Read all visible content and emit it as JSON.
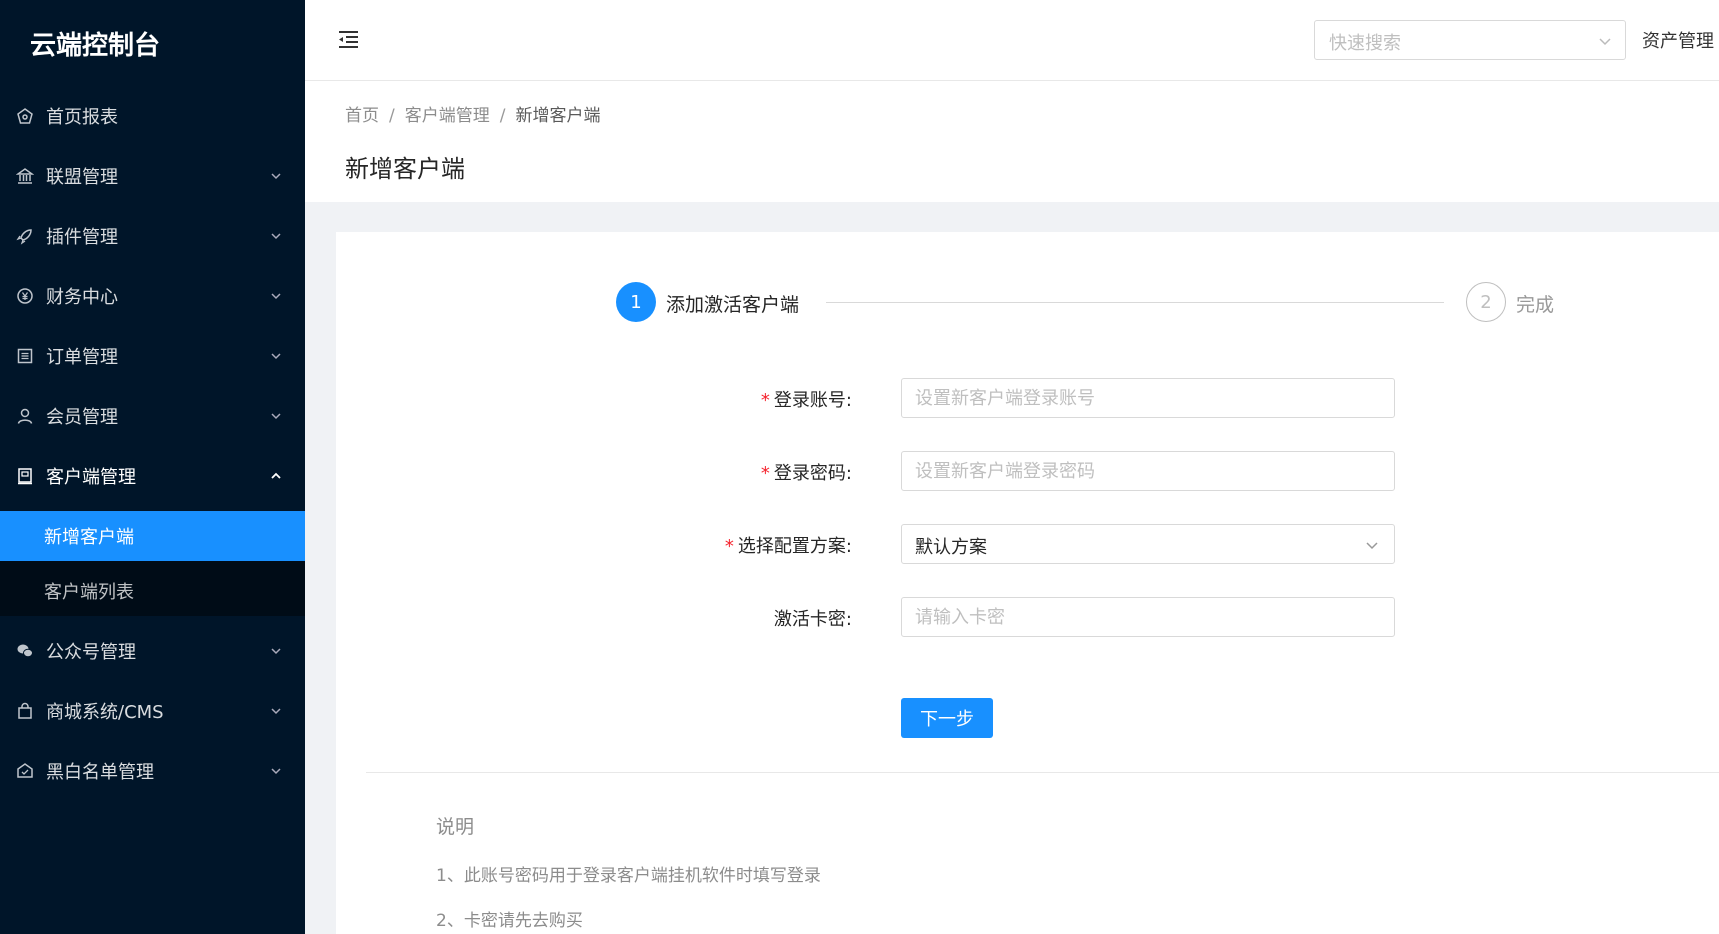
{
  "sidebar": {
    "logo": "云端控制台",
    "items": [
      {
        "label": "首页报表",
        "icon": "dashboard-icon"
      },
      {
        "label": "联盟管理",
        "icon": "bank-icon"
      },
      {
        "label": "插件管理",
        "icon": "rocket-icon"
      },
      {
        "label": "财务中心",
        "icon": "yen-icon"
      },
      {
        "label": "订单管理",
        "icon": "order-list-icon"
      },
      {
        "label": "会员管理",
        "icon": "user-icon"
      },
      {
        "label": "客户端管理",
        "icon": "client-icon"
      },
      {
        "label": "公众号管理",
        "icon": "wechat-icon"
      },
      {
        "label": "商城系统/CMS",
        "icon": "shopping-bag-icon"
      },
      {
        "label": "黑白名单管理",
        "icon": "safety-icon"
      }
    ],
    "client_submenu": [
      "新增客户端",
      "客户端列表"
    ]
  },
  "header": {
    "search_placeholder": "快速搜索",
    "right_link": "资产管理"
  },
  "breadcrumb": [
    "首页",
    "客户端管理",
    "新增客户端"
  ],
  "page_title": "新增客户端",
  "steps": [
    {
      "number": "1",
      "label": "添加激活客户端",
      "status": "active"
    },
    {
      "number": "2",
      "label": "完成",
      "status": "waiting"
    }
  ],
  "form": {
    "account": {
      "label": "登录账号:",
      "placeholder": "设置新客户端登录账号",
      "required": true
    },
    "password": {
      "label": "登录密码:",
      "placeholder": "设置新客户端登录密码",
      "required": true
    },
    "plan": {
      "label": "选择配置方案:",
      "value": "默认方案",
      "required": true
    },
    "card": {
      "label": "激活卡密:",
      "placeholder": "请输入卡密",
      "required": false
    },
    "next_button": "下一步",
    "required_mark": "*"
  },
  "notes": {
    "title": "说明",
    "lines": [
      "1、此账号密码用于登录客户端挂机软件时填写登录",
      "2、卡密请先去购买"
    ]
  },
  "colors": {
    "primary": "#1890ff",
    "sidebar_bg": "#001529",
    "submenu_bg": "#000c17",
    "required": "#f5222d"
  }
}
